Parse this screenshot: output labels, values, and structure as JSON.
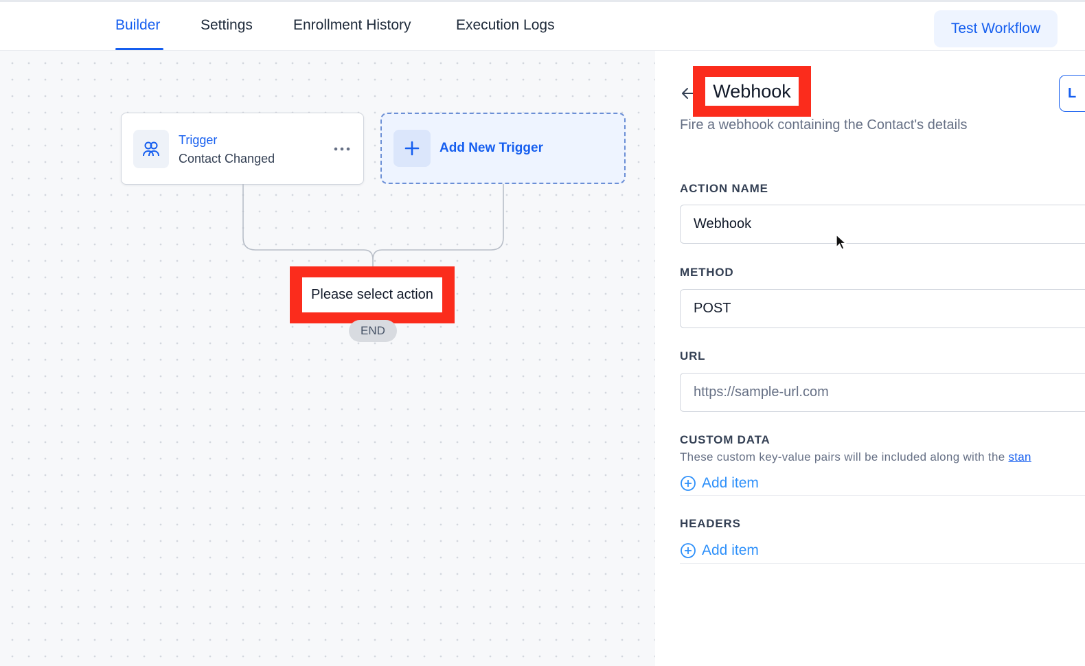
{
  "nav": {
    "tabs": [
      {
        "label": "Builder",
        "active": true
      },
      {
        "label": "Settings",
        "active": false
      },
      {
        "label": "Enrollment History",
        "active": false
      },
      {
        "label": "Execution Logs",
        "active": false
      }
    ],
    "test_button": "Test Workflow"
  },
  "canvas": {
    "trigger": {
      "label": "Trigger",
      "value": "Contact Changed",
      "icon": "users-icon"
    },
    "add_trigger": "Add New Trigger",
    "action_placeholder": "Please select action",
    "end_label": "END"
  },
  "panel": {
    "title": "Webhook",
    "subtitle": "Fire a webhook containing the Contact's details",
    "right_button": "L",
    "fields": {
      "action_name": {
        "label": "ACTION NAME",
        "value": "Webhook"
      },
      "method": {
        "label": "METHOD",
        "value": "POST"
      },
      "url": {
        "label": "URL",
        "placeholder": "https://sample-url.com"
      },
      "custom_data": {
        "label": "CUSTOM DATA",
        "helper": "These custom key-value pairs will be included along with the ",
        "helper_link": "stan",
        "add_item": "Add item"
      },
      "headers": {
        "label": "HEADERS",
        "add_item": "Add item"
      }
    }
  },
  "colors": {
    "accent": "#155eef",
    "highlight": "#fb2c1c",
    "link": "#2e90fa"
  }
}
